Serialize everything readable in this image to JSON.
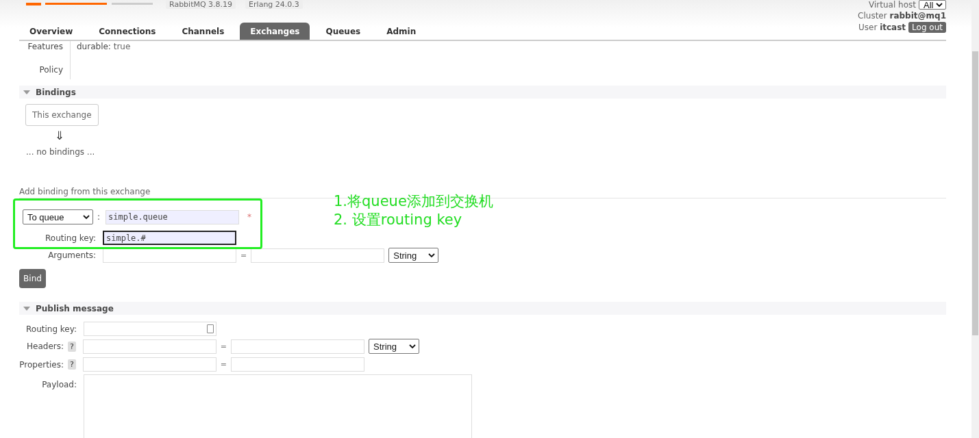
{
  "header": {
    "versions": [
      "RabbitMQ 3.8.19",
      "Erlang 24.0.3"
    ],
    "virtual_host": {
      "label": "Virtual host",
      "value": "All"
    },
    "cluster": {
      "label": "Cluster",
      "value": "rabbit@mq1"
    },
    "user": {
      "label": "User",
      "value": "itcast"
    },
    "logout_button": "Log out"
  },
  "tabs": [
    {
      "label": "Overview",
      "selected": false
    },
    {
      "label": "Connections",
      "selected": false
    },
    {
      "label": "Channels",
      "selected": false
    },
    {
      "label": "Exchanges",
      "selected": true
    },
    {
      "label": "Queues",
      "selected": false
    },
    {
      "label": "Admin",
      "selected": false
    }
  ],
  "details": [
    {
      "label": "Features",
      "key": "durable:",
      "value": "true"
    },
    {
      "label": "Policy"
    }
  ],
  "bindings": {
    "title": "Bindings",
    "expanded": true,
    "node": "This exchange",
    "arrow": "⇓",
    "empty": "... no bindings ..."
  },
  "add_binding": {
    "title": "Add binding from this exchange",
    "destination": "To queue",
    "separator": ":",
    "destination_name": "simple.queue",
    "required_mark": "*",
    "routing_key_label": "Routing key:",
    "routing_key": "simple.#",
    "arguments_label": "Arguments:",
    "equals": "=",
    "argument_type": "String",
    "bind_button": "Bind"
  },
  "publish": {
    "title": "Publish message",
    "expanded": true,
    "routing_key_label": "Routing key:",
    "headers_label": "Headers:",
    "properties_label": "Properties:",
    "help": "?",
    "equals": "=",
    "header_type": "String",
    "payload_label": "Payload:"
  },
  "annotation": {
    "lines": [
      "1.将queue添加到交换机",
      "2. 设置routing key"
    ]
  }
}
